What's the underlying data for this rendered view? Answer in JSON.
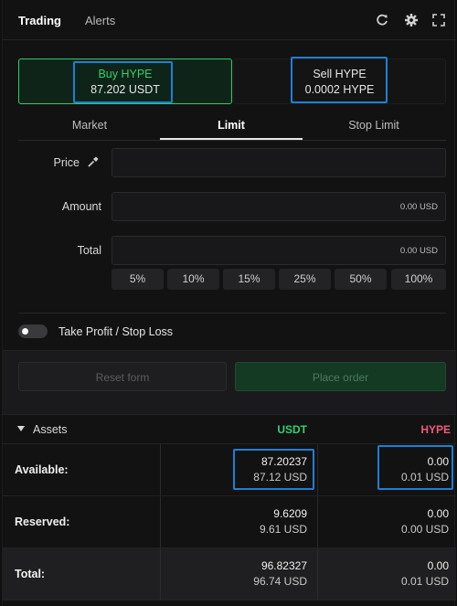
{
  "header": {
    "tabs": [
      {
        "label": "Trading"
      },
      {
        "label": "Alerts"
      }
    ],
    "icons": [
      "refresh-icon",
      "gear-icon",
      "expand-icon"
    ]
  },
  "side": {
    "buy": {
      "title": "Buy HYPE",
      "amount": "87.202 USDT"
    },
    "sell": {
      "title": "Sell HYPE",
      "amount": "0.0002 HYPE"
    }
  },
  "order_tabs": [
    {
      "label": "Market"
    },
    {
      "label": "Limit"
    },
    {
      "label": "Stop Limit"
    }
  ],
  "form": {
    "price_label": "Price",
    "amount_label": "Amount",
    "total_label": "Total",
    "amount_suffix": "0.00 USD",
    "total_suffix": "0.00 USD",
    "percents": [
      "5%",
      "10%",
      "15%",
      "25%",
      "50%",
      "100%"
    ],
    "tpsl_label": "Take Profit / Stop Loss",
    "reset_label": "Reset form",
    "place_label": "Place order"
  },
  "assets": {
    "title": "Assets",
    "col_usdt": "USDT",
    "col_hype": "HYPE",
    "rows": [
      {
        "label": "Available:",
        "usdt": "87.20237",
        "usdt_usd": "87.12 USD",
        "hype": "0.00",
        "hype_usd": "0.01 USD"
      },
      {
        "label": "Reserved:",
        "usdt": "9.6209",
        "usdt_usd": "9.61 USD",
        "hype": "0.00",
        "hype_usd": "0.00 USD"
      },
      {
        "label": "Total:",
        "usdt": "96.82327",
        "usdt_usd": "96.74 USD",
        "hype": "0.00",
        "hype_usd": "0.01 USD"
      }
    ]
  },
  "colors": {
    "buy": "#32d06f",
    "sell_hype": "#f0597a",
    "highlight": "#1e7fd6"
  }
}
